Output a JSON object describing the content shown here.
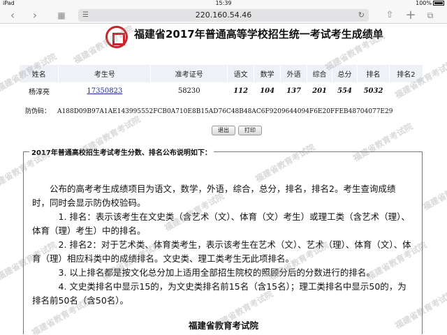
{
  "status_bar": {
    "device": "iPad",
    "time": "15:39",
    "battery": "100%"
  },
  "browser": {
    "url": "220.160.54.46"
  },
  "header": {
    "title": "福建省2017年普通高等学校招生统一考试考生成绩单"
  },
  "score_table": {
    "columns": [
      "姓名",
      "考生号",
      "准考证号",
      "语文",
      "数学",
      "外语",
      "综合",
      "总分",
      "排名",
      "排名2"
    ],
    "row": {
      "name": "杨淳亮",
      "exam_id": "17350823",
      "admission_id": "58230",
      "chinese": "112",
      "math": "104",
      "foreign": "137",
      "comprehensive": "201",
      "total": "554",
      "rank": "5032",
      "rank2": ""
    }
  },
  "anti_fake": {
    "label": "防伪码：",
    "code": "A188D09B97A1AE143995552FCB0A710E8B15AD76C48B48AC6F9209644094F6E20FFEB48704077E29"
  },
  "buttons": {
    "exit": "退出",
    "print": "打印"
  },
  "notice": {
    "legend": "2017年普通高校招生考试考生分数、排名公布说明如下：",
    "intro": "公布的高考考生成绩项目为语文，数学，外语，综合，总分，排名，排名2。考生查询成绩时，同时会显示防伪校验码。",
    "item1": "1. 排名：表示该考生在文史类（含艺术（文）、体育（文）考生）或理工类（含艺术（理）、体育（理）考生）中的排名。",
    "item2": "2. 排名2：对于艺术类、体育类考生，表示该考生在艺术（文）、艺术（理）、体育（文）、体育（理）相应科类中的成绩排名。文史类、理工类考生无此项排名。",
    "item3": "3. 以上排名都是按文化总分加上适用全部招生院校的照顾分后的分数进行的排名。",
    "item4": "4. 文史类排名中显示15的，为文史类排名前15名（含15名）；理工类排名中显示50的，为排名前50名（含50名）。"
  },
  "footer": {
    "org": "福建省教育考试院"
  },
  "watermark": {
    "text": "福建省教育考试院"
  },
  "colors": {
    "logo_red": "#c8262b",
    "link_blue": "#1b2b9c",
    "header_bg": "#eef2f7"
  }
}
